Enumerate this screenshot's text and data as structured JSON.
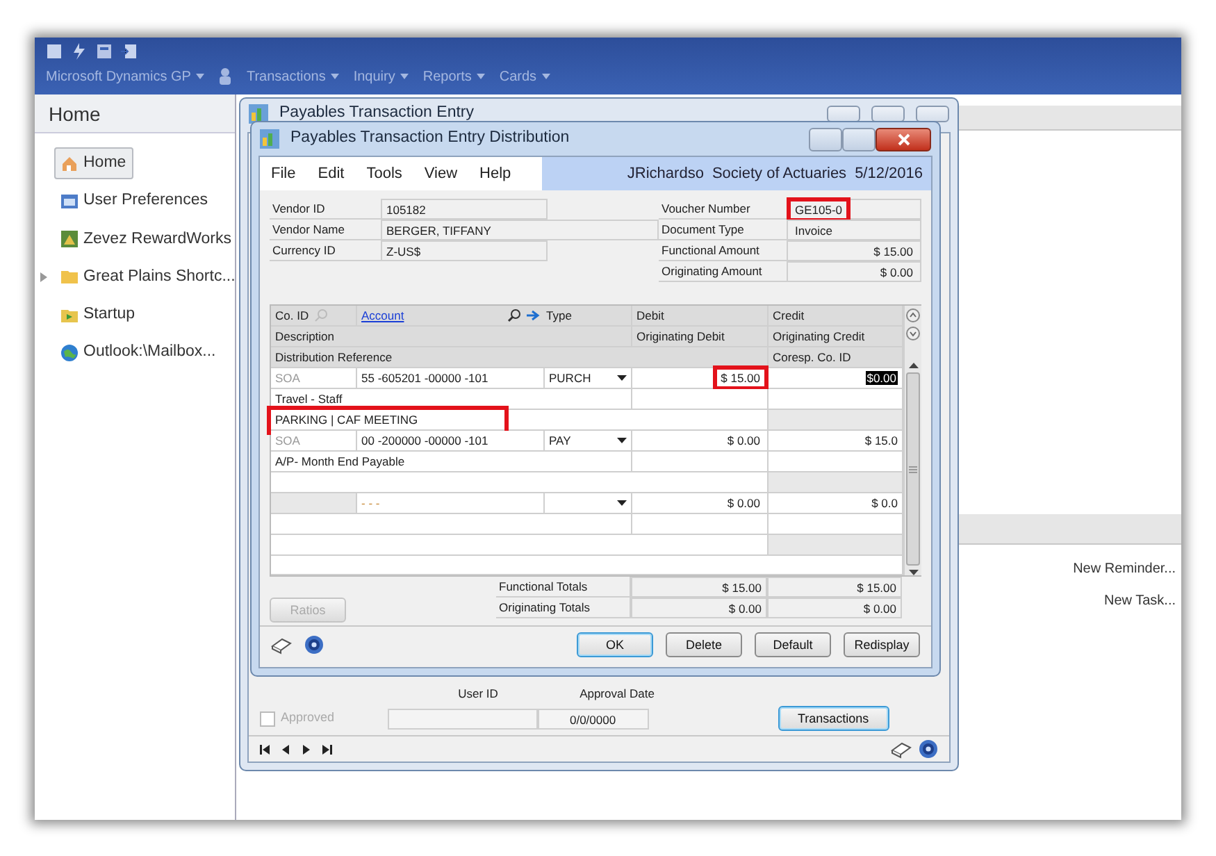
{
  "toolbar": {
    "menu": [
      {
        "label": "Microsoft Dynamics GP"
      },
      {
        "label": "Transactions"
      },
      {
        "label": "Inquiry"
      },
      {
        "label": "Reports"
      },
      {
        "label": "Cards"
      }
    ]
  },
  "navigation_pane": {
    "title": "Home",
    "items": [
      {
        "label": "Home",
        "selected": true,
        "expandable": false
      },
      {
        "label": "User Preferences",
        "selected": false,
        "expandable": false
      },
      {
        "label": "Zevez RewardWorks",
        "selected": false,
        "expandable": false
      },
      {
        "label": "Great Plains Shortc...",
        "selected": false,
        "expandable": true
      },
      {
        "label": "Startup",
        "selected": false,
        "expandable": false
      },
      {
        "label": "Outlook:\\Mailbox...",
        "selected": false,
        "expandable": false
      }
    ]
  },
  "home_page": {
    "links": [
      "New Reminder...",
      "New Task..."
    ]
  },
  "background_window": {
    "title": "Payables Transaction Entry",
    "approved": {
      "label": "Approved",
      "checked": false,
      "disabled": true
    },
    "columns": [
      "User ID",
      "Approval Date"
    ],
    "approval_date": "0/0/0000",
    "button": "Transactions"
  },
  "dialog": {
    "title": "Payables Transaction Entry Distribution",
    "menu": [
      "File",
      "Edit",
      "Tools",
      "View",
      "Help"
    ],
    "status": {
      "user": "JRichardso",
      "company": "Society of Actuaries",
      "date": "5/12/2016"
    },
    "fields_left": [
      {
        "label": "Vendor ID",
        "value": "105182",
        "wide": false
      },
      {
        "label": "Vendor Name",
        "value": "BERGER, TIFFANY",
        "wide": true
      },
      {
        "label": "Currency ID",
        "value": "Z-US$",
        "wide": false
      }
    ],
    "fields_right": [
      {
        "label": "Voucher Number",
        "value": "GE105-0",
        "highlighted": true
      },
      {
        "label": "Document Type",
        "value": "Invoice",
        "highlighted": false
      },
      {
        "label": "Functional Amount",
        "value": "$ 15.00",
        "highlighted": false
      },
      {
        "label": "Originating Amount",
        "value": "$ 0.00",
        "highlighted": false
      }
    ],
    "grid": {
      "headers": {
        "co_id": "Co. ID",
        "account": "Account",
        "type": "Type",
        "debit": "Debit",
        "credit": "Credit",
        "description": "Description",
        "originating_debit": "Originating Debit",
        "originating_credit": "Originating Credit",
        "distribution_reference": "Distribution Reference",
        "coresp_co_id": "Coresp. Co. ID"
      },
      "rows": [
        {
          "co_id": "SOA",
          "account": "55 -605201 -00000 -101",
          "type": "PURCH",
          "debit": "$ 15.00",
          "debit_highlighted": true,
          "credit": "$0.00",
          "credit_selected": true,
          "description": "Travel - Staff",
          "reference": "PARKING | CAF MEETING",
          "reference_highlighted": true
        },
        {
          "co_id": "SOA",
          "account": "00 -200000 -00000 -101",
          "type": "PAY",
          "debit": "$ 0.00",
          "debit_highlighted": false,
          "credit": "$ 15.0",
          "credit_selected": false,
          "description": "A/P- Month End Payable",
          "reference_highlighted": false
        },
        {
          "account": "-      -      -",
          "debit": "$ 0.00",
          "debit_highlighted": false,
          "credit": "$ 0.0",
          "credit_selected": false,
          "reference_highlighted": false
        }
      ]
    },
    "totals": [
      {
        "label": "Functional Totals",
        "debit": "$ 15.00",
        "credit": "$ 15.00"
      },
      {
        "label": "Originating Totals",
        "debit": "$ 0.00",
        "credit": "$ 0.00"
      }
    ],
    "buttons": [
      {
        "label": "Ratios",
        "disabled": true,
        "default": false
      },
      {
        "label": "OK",
        "disabled": false,
        "default": true
      },
      {
        "label": "Delete",
        "disabled": false,
        "default": false
      },
      {
        "label": "Default",
        "disabled": false,
        "default": false
      },
      {
        "label": "Redisplay",
        "disabled": false,
        "default": false
      }
    ]
  }
}
